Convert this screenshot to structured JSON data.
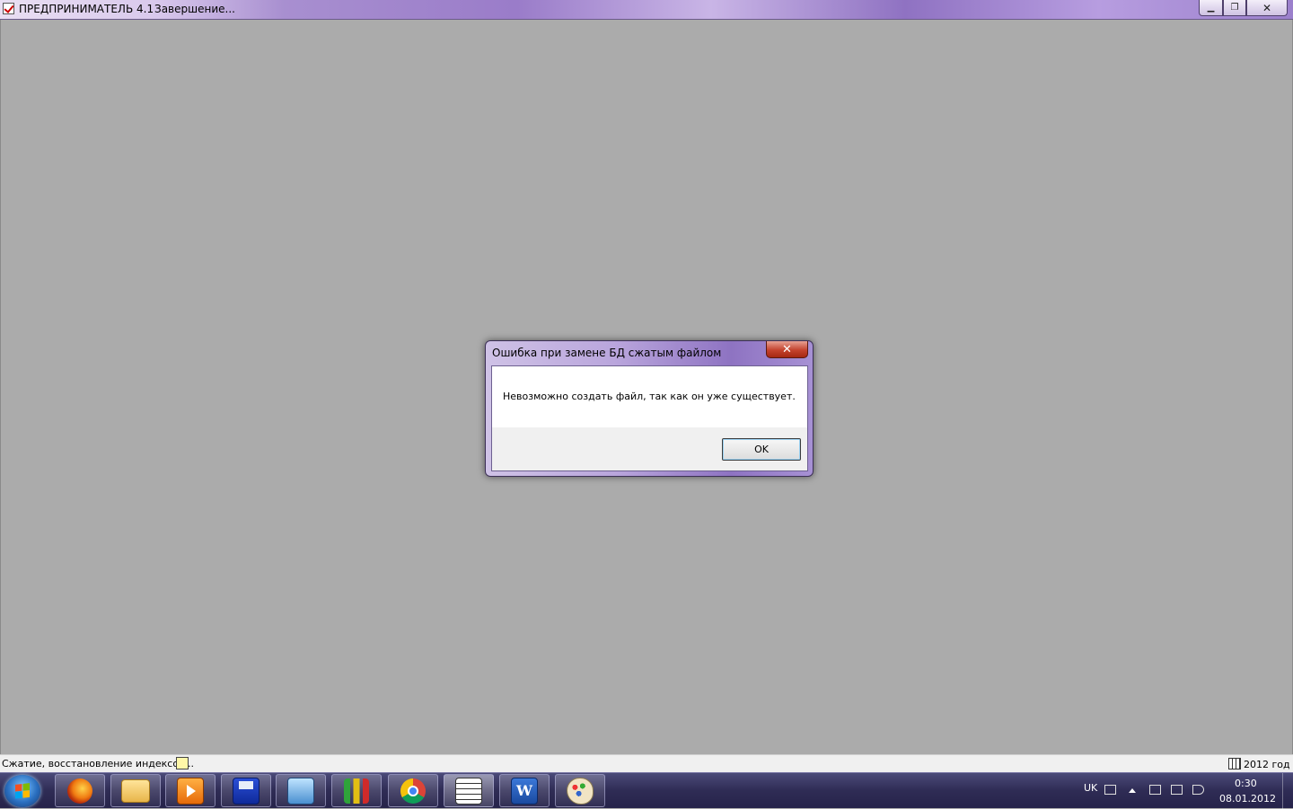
{
  "window": {
    "title": "ПРЕДПРИНИМАТЕЛЬ 4.1",
    "subtitle": "Завершение...",
    "minimize_glyph": "▁",
    "maximize_glyph": "❐",
    "close_glyph": "✕"
  },
  "dialog": {
    "title": "Ошибка при замене БД сжатым файлом",
    "close_glyph": "✕",
    "message": "Невозможно создать файл, так как он уже существует.",
    "ok_label": "OK"
  },
  "statusbar": {
    "left_text": "Сжатие, восстановление индексов...",
    "right_text": "2012 год"
  },
  "taskbar": {
    "items": [
      {
        "icon": "firefox-icon"
      },
      {
        "icon": "folder-icon"
      },
      {
        "icon": "media-player-icon"
      },
      {
        "icon": "floppy-disk-icon"
      },
      {
        "icon": "monitor-icon"
      },
      {
        "icon": "bar-chart-app-icon"
      },
      {
        "icon": "chrome-icon"
      },
      {
        "icon": "checklist-app-icon",
        "active": true
      },
      {
        "icon": "word-icon",
        "glyph": "W"
      },
      {
        "icon": "paint-icon"
      }
    ],
    "tray": {
      "language": "UK",
      "time": "0:30",
      "date": "08.01.2012"
    }
  },
  "colors": {
    "desktop": "#ababab",
    "dialog_close": "#c4432d",
    "taskbar": "#2f2c55"
  }
}
